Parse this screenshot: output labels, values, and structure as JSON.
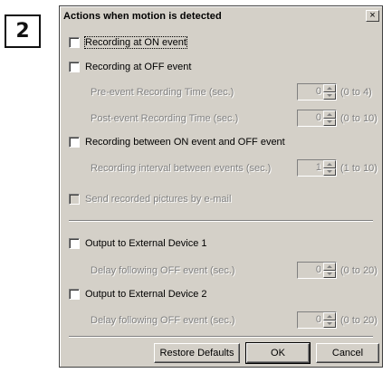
{
  "step_number": "2",
  "dialog": {
    "title": "Actions when motion is detected",
    "close_label": "×"
  },
  "options": {
    "record_on_event": {
      "label": "Recording at ON event",
      "checked": false
    },
    "record_off_event": {
      "label": "Recording at OFF event",
      "checked": false
    },
    "pre_event": {
      "label": "Pre-event Recording Time (sec.)",
      "value": "0",
      "range": "(0 to 4)"
    },
    "post_event": {
      "label": "Post-event Recording Time (sec.)",
      "value": "0",
      "range": "(0 to 10)"
    },
    "record_between": {
      "label": "Recording between ON event and OFF event",
      "checked": false
    },
    "interval": {
      "label": "Recording interval between events (sec.)",
      "value": "1",
      "range": "(1 to 10)"
    },
    "send_email": {
      "label": "Send recorded pictures by e-mail",
      "checked": false
    },
    "external1": {
      "label": "Output to External Device 1",
      "checked": false
    },
    "delay1": {
      "label": "Delay following OFF event (sec.)",
      "value": "0",
      "range": "(0 to 20)"
    },
    "external2": {
      "label": "Output to External Device 2",
      "checked": false
    },
    "delay2": {
      "label": "Delay following OFF event (sec.)",
      "value": "0",
      "range": "(0 to 20)"
    }
  },
  "buttons": {
    "restore": "Restore Defaults",
    "ok": "OK",
    "cancel": "Cancel"
  }
}
